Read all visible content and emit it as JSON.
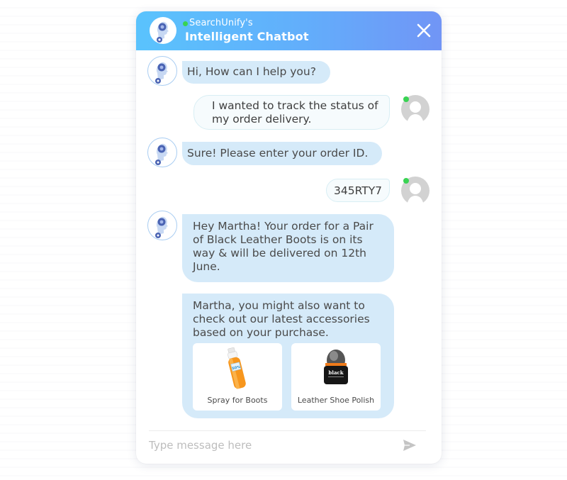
{
  "header": {
    "subtitle": "SearchUnify's",
    "title": "Intelligent Chatbot",
    "status": "online",
    "close_icon": "close-icon"
  },
  "messages": [
    {
      "sender": "bot",
      "text": "Hi, How can I help you?"
    },
    {
      "sender": "user",
      "text": "I wanted to track the status of my order delivery.",
      "status": "online"
    },
    {
      "sender": "bot",
      "text": "Sure! Please enter your order ID."
    },
    {
      "sender": "user",
      "text": "345RTY7",
      "status": "online"
    },
    {
      "sender": "bot",
      "text": "Hey Martha! Your order for a Pair of Black Leather Boots is on its way & will be delivered on 12th June."
    },
    {
      "sender": "bot",
      "text": "Martha, you might also want to check out our latest accessories based on your purchase.",
      "products": [
        {
          "name": "Spray for Boots",
          "image": "orange-spray-bottle",
          "label_on_product": "50%"
        },
        {
          "name": "Leather Shoe Polish",
          "image": "black-polish-bottle",
          "label_on_product": "black"
        }
      ]
    }
  ],
  "composer": {
    "placeholder": "Type message here",
    "value": "",
    "send_icon": "send-icon"
  },
  "colors": {
    "header_gradient_start": "#5ac3fd",
    "header_gradient_end": "#7195f6",
    "bot_bubble": "#d5eaf9",
    "user_bubble": "#f6fbfd",
    "online": "#39d353"
  }
}
